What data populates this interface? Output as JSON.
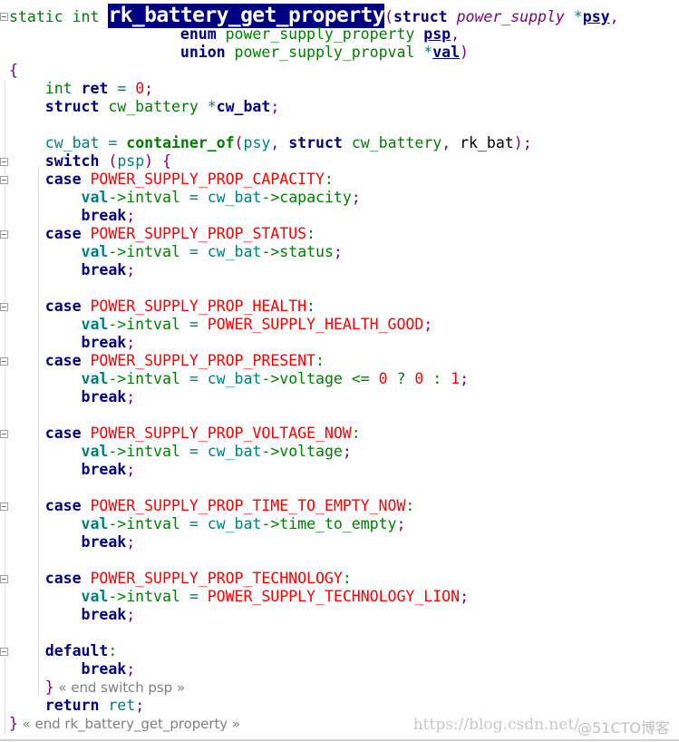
{
  "editor": {
    "colors": {
      "keyword": "#000080",
      "type": "#008000",
      "variable": "#008080",
      "constant": "#ff0000",
      "punctuation": "#800080",
      "highlight": "#000080",
      "comment": "#808080"
    },
    "fold_lines": [
      1,
      9,
      10,
      13,
      17,
      20,
      24,
      28,
      32,
      36
    ],
    "lines": [
      [
        [
          "static int ",
          "type"
        ],
        [
          "rk_battery_get_property",
          "hl"
        ],
        [
          "(",
          "punct"
        ],
        [
          "struct",
          "kw"
        ],
        [
          " ",
          "plain"
        ],
        [
          "power_supply",
          "ital"
        ],
        [
          " ",
          "plain"
        ],
        [
          "*",
          "op"
        ],
        [
          "psy",
          "param"
        ],
        [
          ",",
          "punct"
        ]
      ],
      [
        [
          "                   ",
          "plain"
        ],
        [
          "enum",
          "kw"
        ],
        [
          " power_supply_property ",
          "type"
        ],
        [
          "psp",
          "param"
        ],
        [
          ",",
          "punct"
        ]
      ],
      [
        [
          "                   ",
          "plain"
        ],
        [
          "union",
          "kw"
        ],
        [
          " power_supply_propval ",
          "type"
        ],
        [
          "*",
          "op"
        ],
        [
          "val",
          "param"
        ],
        [
          ")",
          "punct"
        ]
      ],
      [
        [
          "{",
          "punct"
        ]
      ],
      [
        [
          "    ",
          "plain"
        ],
        [
          "int",
          "type"
        ],
        [
          " ",
          "plain"
        ],
        [
          "ret",
          "decl"
        ],
        [
          " = ",
          "op"
        ],
        [
          "0",
          "const"
        ],
        [
          ";",
          "punct"
        ]
      ],
      [
        [
          "    ",
          "plain"
        ],
        [
          "struct",
          "kw"
        ],
        [
          " cw_battery ",
          "type"
        ],
        [
          "*",
          "op"
        ],
        [
          "cw_bat",
          "decl"
        ],
        [
          ";",
          "punct"
        ]
      ],
      [],
      [
        [
          "    ",
          "plain"
        ],
        [
          "cw_bat",
          "var"
        ],
        [
          " = ",
          "op"
        ],
        [
          "container_of",
          "fn"
        ],
        [
          "(",
          "punct"
        ],
        [
          "psy",
          "var"
        ],
        [
          ", ",
          "punct"
        ],
        [
          "struct",
          "kw"
        ],
        [
          " cw_battery",
          "type"
        ],
        [
          ", ",
          "punct"
        ],
        [
          "rk_bat",
          "plain"
        ],
        [
          ");",
          "punct"
        ]
      ],
      [
        [
          "    ",
          "plain"
        ],
        [
          "switch",
          "kw"
        ],
        [
          " (",
          "punct"
        ],
        [
          "psp",
          "var"
        ],
        [
          ") {",
          "punct"
        ]
      ],
      [
        [
          "    ",
          "plain"
        ],
        [
          "case",
          "kw"
        ],
        [
          " POWER_SUPPLY_PROP_CAPACITY",
          "const"
        ],
        [
          ":",
          "mem"
        ]
      ],
      [
        [
          "        ",
          "plain"
        ],
        [
          "val",
          "bvar"
        ],
        [
          "->intval",
          "mem"
        ],
        [
          " = ",
          "op"
        ],
        [
          "cw_bat",
          "var"
        ],
        [
          "->capacity",
          "mem"
        ],
        [
          ";",
          "punct"
        ]
      ],
      [
        [
          "        ",
          "plain"
        ],
        [
          "break",
          "kw"
        ],
        [
          ";",
          "punct"
        ]
      ],
      [
        [
          "    ",
          "plain"
        ],
        [
          "case",
          "kw"
        ],
        [
          " POWER_SUPPLY_PROP_STATUS",
          "const"
        ],
        [
          ":",
          "mem"
        ]
      ],
      [
        [
          "        ",
          "plain"
        ],
        [
          "val",
          "bvar"
        ],
        [
          "->intval",
          "mem"
        ],
        [
          " = ",
          "op"
        ],
        [
          "cw_bat",
          "var"
        ],
        [
          "->status",
          "mem"
        ],
        [
          ";",
          "punct"
        ]
      ],
      [
        [
          "        ",
          "plain"
        ],
        [
          "break",
          "kw"
        ],
        [
          ";",
          "punct"
        ]
      ],
      [],
      [
        [
          "    ",
          "plain"
        ],
        [
          "case",
          "kw"
        ],
        [
          " POWER_SUPPLY_PROP_HEALTH",
          "const"
        ],
        [
          ":",
          "mem"
        ]
      ],
      [
        [
          "        ",
          "plain"
        ],
        [
          "val",
          "bvar"
        ],
        [
          "->intval",
          "mem"
        ],
        [
          " = ",
          "op"
        ],
        [
          "POWER_SUPPLY_HEALTH_GOOD",
          "const"
        ],
        [
          ";",
          "punct"
        ]
      ],
      [
        [
          "        ",
          "plain"
        ],
        [
          "break",
          "kw"
        ],
        [
          ";",
          "punct"
        ]
      ],
      [
        [
          "    ",
          "plain"
        ],
        [
          "case",
          "kw"
        ],
        [
          " POWER_SUPPLY_PROP_PRESENT",
          "const"
        ],
        [
          ":",
          "mem"
        ]
      ],
      [
        [
          "        ",
          "plain"
        ],
        [
          "val",
          "bvar"
        ],
        [
          "->intval",
          "mem"
        ],
        [
          " = ",
          "op"
        ],
        [
          "cw_bat",
          "var"
        ],
        [
          "->voltage <= ",
          "mem"
        ],
        [
          "0",
          "const"
        ],
        [
          " ? ",
          "mem"
        ],
        [
          "0",
          "const"
        ],
        [
          " : ",
          "mem"
        ],
        [
          "1",
          "const"
        ],
        [
          ";",
          "punct"
        ]
      ],
      [
        [
          "        ",
          "plain"
        ],
        [
          "break",
          "kw"
        ],
        [
          ";",
          "punct"
        ]
      ],
      [],
      [
        [
          "    ",
          "plain"
        ],
        [
          "case",
          "kw"
        ],
        [
          " POWER_SUPPLY_PROP_VOLTAGE_NOW",
          "const"
        ],
        [
          ":",
          "mem"
        ]
      ],
      [
        [
          "        ",
          "plain"
        ],
        [
          "val",
          "bvar"
        ],
        [
          "->intval",
          "mem"
        ],
        [
          " = ",
          "op"
        ],
        [
          "cw_bat",
          "var"
        ],
        [
          "->voltage",
          "mem"
        ],
        [
          ";",
          "punct"
        ]
      ],
      [
        [
          "        ",
          "plain"
        ],
        [
          "break",
          "kw"
        ],
        [
          ";",
          "punct"
        ]
      ],
      [],
      [
        [
          "    ",
          "plain"
        ],
        [
          "case",
          "kw"
        ],
        [
          " POWER_SUPPLY_PROP_TIME_TO_EMPTY_NOW",
          "const"
        ],
        [
          ":",
          "mem"
        ]
      ],
      [
        [
          "        ",
          "plain"
        ],
        [
          "val",
          "bvar"
        ],
        [
          "->intval",
          "mem"
        ],
        [
          " = ",
          "op"
        ],
        [
          "cw_bat",
          "var"
        ],
        [
          "->time_to_empty",
          "mem"
        ],
        [
          ";",
          "punct"
        ]
      ],
      [
        [
          "        ",
          "plain"
        ],
        [
          "break",
          "kw"
        ],
        [
          ";",
          "punct"
        ]
      ],
      [],
      [
        [
          "    ",
          "plain"
        ],
        [
          "case",
          "kw"
        ],
        [
          " POWER_SUPPLY_PROP_TECHNOLOGY",
          "const"
        ],
        [
          ":",
          "mem"
        ]
      ],
      [
        [
          "        ",
          "plain"
        ],
        [
          "val",
          "bvar"
        ],
        [
          "->intval",
          "mem"
        ],
        [
          " = ",
          "op"
        ],
        [
          "POWER_SUPPLY_TECHNOLOGY_LION",
          "const"
        ],
        [
          ";",
          "punct"
        ]
      ],
      [
        [
          "        ",
          "plain"
        ],
        [
          "break",
          "kw"
        ],
        [
          ";",
          "punct"
        ]
      ],
      [],
      [
        [
          "    ",
          "plain"
        ],
        [
          "default",
          "kw"
        ],
        [
          ":",
          "mem"
        ]
      ],
      [
        [
          "        ",
          "plain"
        ],
        [
          "break",
          "kw"
        ],
        [
          ";",
          "punct"
        ]
      ],
      [
        [
          "    ",
          "plain"
        ],
        [
          "}",
          "punct"
        ],
        [
          " « end switch psp »",
          "comment"
        ]
      ],
      [
        [
          "    ",
          "plain"
        ],
        [
          "return",
          "kw"
        ],
        [
          " ret",
          "var"
        ],
        [
          ";",
          "punct"
        ]
      ],
      [
        [
          "}",
          "punct"
        ],
        [
          " « end rk_battery_get_property »",
          "comment"
        ]
      ]
    ]
  },
  "watermark": {
    "url": "https://blog.csdn.net/",
    "brand": "@51CTO博客"
  }
}
